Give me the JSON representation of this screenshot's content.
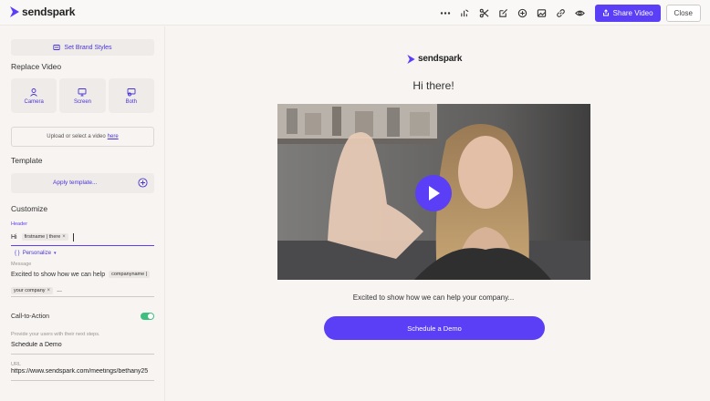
{
  "app": {
    "name": "sendspark"
  },
  "toolbar": {
    "icons": [
      "more-icon",
      "analytics-icon",
      "trim-icon",
      "edit-icon",
      "add-icon",
      "image-icon",
      "link-icon",
      "preview-icon"
    ],
    "share_label": "Share Video",
    "close_label": "Close"
  },
  "sidebar": {
    "brand_styles_label": "Set Brand Styles",
    "replace_video": {
      "title": "Replace Video",
      "options": [
        {
          "label": "Camera",
          "icon": "camera-icon"
        },
        {
          "label": "Screen",
          "icon": "screen-icon"
        },
        {
          "label": "Both",
          "icon": "both-icon"
        }
      ],
      "upload_text": "Upload or select a video",
      "upload_link": "here"
    },
    "template": {
      "title": "Template",
      "apply_label": "Apply template..."
    },
    "customize": {
      "title": "Customize",
      "header_label": "Header",
      "header_prefix": "Hi",
      "header_chip": "firstname | there",
      "personalize_label": "Personalize",
      "message_label": "Message",
      "message_text": "Excited to show how we can help",
      "message_chip1": "companyname |",
      "message_chip2": "your company",
      "message_suffix": "..."
    },
    "cta": {
      "title": "Call-to-Action",
      "enabled": true,
      "helper": "Provide your users with their next steps.",
      "button_value": "Schedule a Demo",
      "url_label": "URL",
      "url_value": "https://www.sendspark.com/meetings/bethany25"
    }
  },
  "preview": {
    "logo": "sendspark",
    "greeting": "Hi there!",
    "caption": "Excited to show how we can help your company...",
    "cta_label": "Schedule a Demo"
  },
  "colors": {
    "accent": "#5b3ff6",
    "toggle_on": "#3fbf7f",
    "background": "#f7f4f2"
  }
}
